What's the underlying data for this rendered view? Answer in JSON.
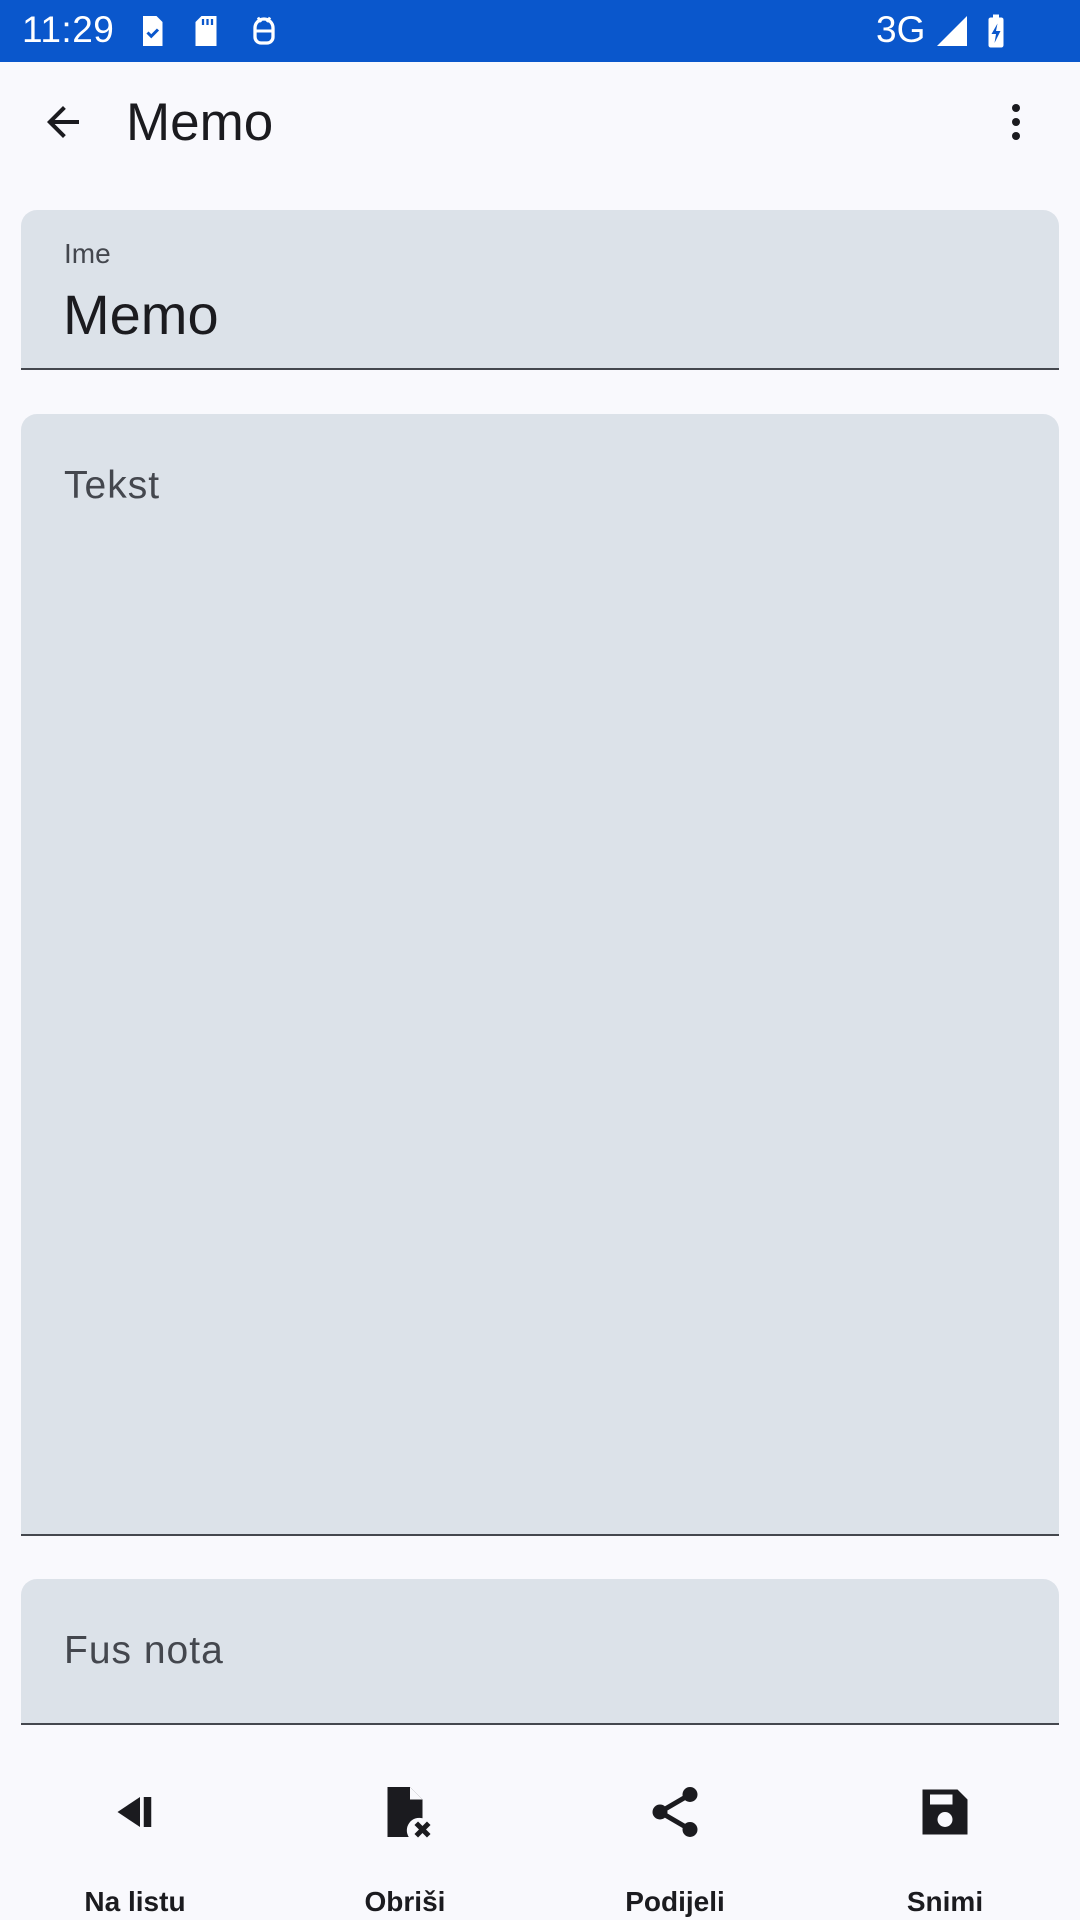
{
  "status_bar": {
    "time": "11:29",
    "network": "3G",
    "notification_icons": [
      "task-check-icon",
      "sd-card-icon",
      "android-robot-icon"
    ],
    "right_icons": [
      "signal-icon",
      "battery-charging-icon"
    ]
  },
  "app_bar": {
    "title": "Memo",
    "back_icon": "arrow-back-icon",
    "menu_icon": "more-vert-icon"
  },
  "form": {
    "name_field": {
      "label": "Ime",
      "value": "Memo"
    },
    "text_field": {
      "placeholder": "Tekst"
    },
    "footnote_field": {
      "placeholder": "Fus nota"
    }
  },
  "bottom_nav": {
    "items": [
      {
        "label": "Na listu",
        "icon": "skip-previous-icon"
      },
      {
        "label": "Obriši",
        "icon": "file-delete-icon"
      },
      {
        "label": "Podijeli",
        "icon": "share-icon"
      },
      {
        "label": "Snimi",
        "icon": "save-icon"
      }
    ]
  },
  "colors": {
    "status_bar": "#0a57cc",
    "background": "#f9f9fd",
    "field_fill": "#dce2e9",
    "field_underline": "#44474e",
    "text_primary": "#1b1b1f",
    "text_secondary": "#44474e"
  }
}
